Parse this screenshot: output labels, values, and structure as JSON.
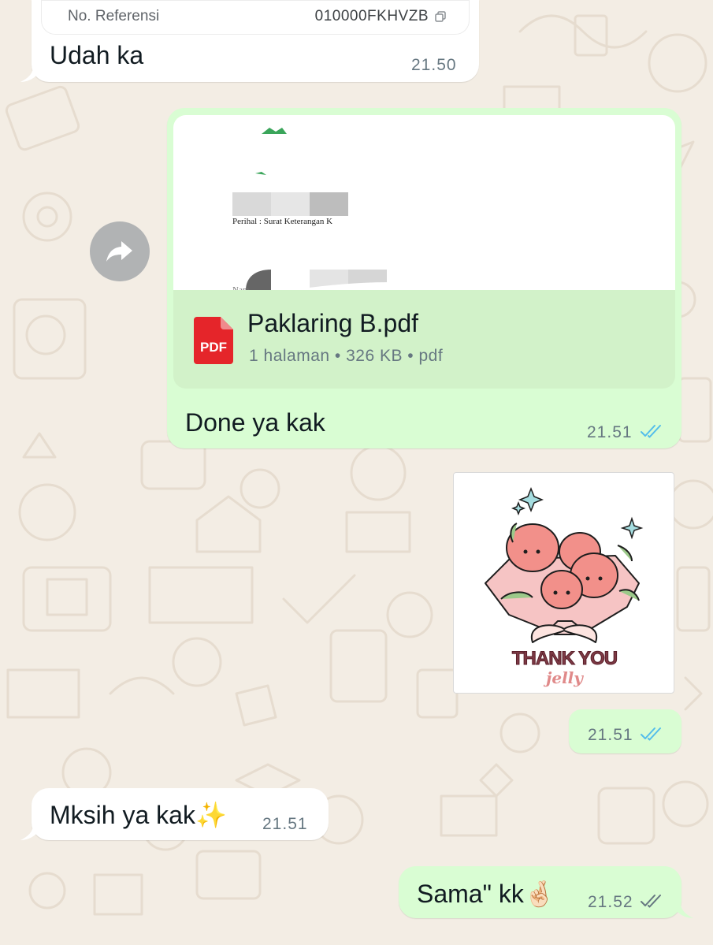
{
  "receipt": {
    "ref_label": "No. Referensi",
    "ref_value": "010000FKHVZB",
    "copy_icon": "copy-icon"
  },
  "messages": [
    {
      "id": "m1",
      "direction": "incoming",
      "text": "Udah ka",
      "time": "21.50"
    },
    {
      "id": "m2",
      "direction": "outgoing",
      "text": "Done ya kak",
      "time": "21.51",
      "status": "read",
      "document": {
        "name": "Paklaring B.pdf",
        "meta": "1 halaman • 326 KB • pdf",
        "icon_label": "PDF",
        "preview_line_1": "Perihal : Surat Keterangan K",
        "preview_line_2": "Nam"
      }
    },
    {
      "id": "m3",
      "direction": "outgoing",
      "type": "sticker",
      "sticker_text": "THANK YOU",
      "sticker_sub": "jelly",
      "time": "21.51",
      "status": "read"
    },
    {
      "id": "m4",
      "direction": "incoming",
      "text": "Mksih ya kak✨",
      "time": "21.51"
    },
    {
      "id": "m5",
      "direction": "outgoing",
      "text": "Sama\" kk🤞🏻",
      "time": "21.52",
      "status": "delivered"
    }
  ],
  "colors": {
    "wallpaper": "#f3ede4",
    "incoming": "#ffffff",
    "outgoing": "#d9fdd3",
    "doc_info": "#d2f2c9",
    "read_tick": "#53bdeb",
    "delivered_tick": "#667781",
    "pdf_red": "#e5252a"
  },
  "icons": {
    "forward": "forward-icon",
    "pdf": "pdf-icon",
    "read": "double-check-icon"
  }
}
